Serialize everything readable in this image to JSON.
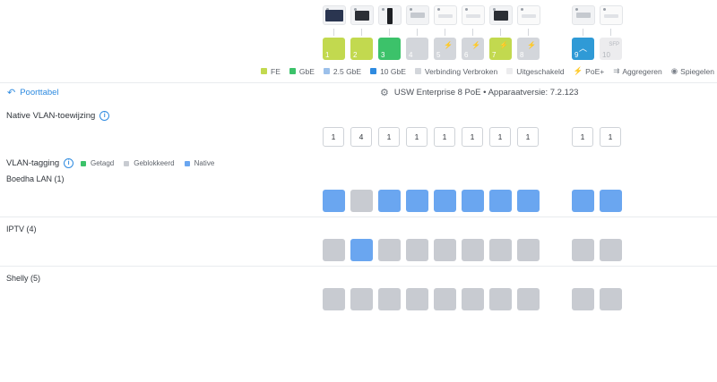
{
  "ports": [
    {
      "num": "1",
      "state": "fe",
      "poe": false
    },
    {
      "num": "2",
      "state": "fe",
      "poe": false
    },
    {
      "num": "3",
      "state": "gbe",
      "poe": false
    },
    {
      "num": "4",
      "state": "off",
      "poe": false
    },
    {
      "num": "5",
      "state": "off",
      "poe": true
    },
    {
      "num": "6",
      "state": "off",
      "poe": true
    },
    {
      "num": "7",
      "state": "fe",
      "poe": true
    },
    {
      "num": "8",
      "state": "off",
      "poe": true
    },
    {
      "num": "9",
      "state": "selected",
      "poe": false
    },
    {
      "num": "10",
      "state": "empty",
      "poe": false,
      "sfp": "SFP"
    }
  ],
  "devices": [
    "tv",
    "dark",
    "tall",
    "flat",
    "white",
    "white",
    "dark",
    "white",
    "flat",
    "white"
  ],
  "colors": {
    "fe": "#c2d94f",
    "gbe": "#3cc26a",
    "g25": "#9cc0ea",
    "g10": "#2f8be0",
    "disconnected": "#d3d6db",
    "disabled": "#ececee",
    "getagd": "#3cc26a",
    "geblokkeerd": "#c8cbd1",
    "native": "#6aa6f0"
  },
  "legend": {
    "fe": "FE",
    "gbe": "GbE",
    "g25": "2.5 GbE",
    "g10": "10 GbE",
    "disconnected": "Verbinding Verbroken",
    "disabled": "Uitgeschakeld",
    "poe": "PoE+",
    "aggregate": "Aggregeren",
    "mirror": "Spiegelen"
  },
  "header": {
    "back_label": "Poorttabel",
    "title": "USW Enterprise 8 PoE • Apparaatversie: 7.2.123"
  },
  "native_vlan": {
    "label": "Native VLAN-toewijzing",
    "values": [
      "1",
      "4",
      "1",
      "1",
      "1",
      "1",
      "1",
      "1",
      "1",
      "1"
    ]
  },
  "vlan_tagging": {
    "label": "VLAN-tagging",
    "legend": {
      "tagged": "Getagd",
      "blocked": "Geblokkeerd",
      "native": "Native"
    },
    "networks": [
      {
        "name": "Boedha LAN (1)",
        "states": [
          "native",
          "blocked",
          "native",
          "native",
          "native",
          "native",
          "native",
          "native",
          "native",
          "native"
        ]
      },
      {
        "name": "IPTV (4)",
        "states": [
          "blocked",
          "native",
          "blocked",
          "blocked",
          "blocked",
          "blocked",
          "blocked",
          "blocked",
          "blocked",
          "blocked"
        ]
      },
      {
        "name": "Shelly (5)",
        "states": [
          "blocked",
          "blocked",
          "blocked",
          "blocked",
          "blocked",
          "blocked",
          "blocked",
          "blocked",
          "blocked",
          "blocked"
        ]
      }
    ]
  }
}
